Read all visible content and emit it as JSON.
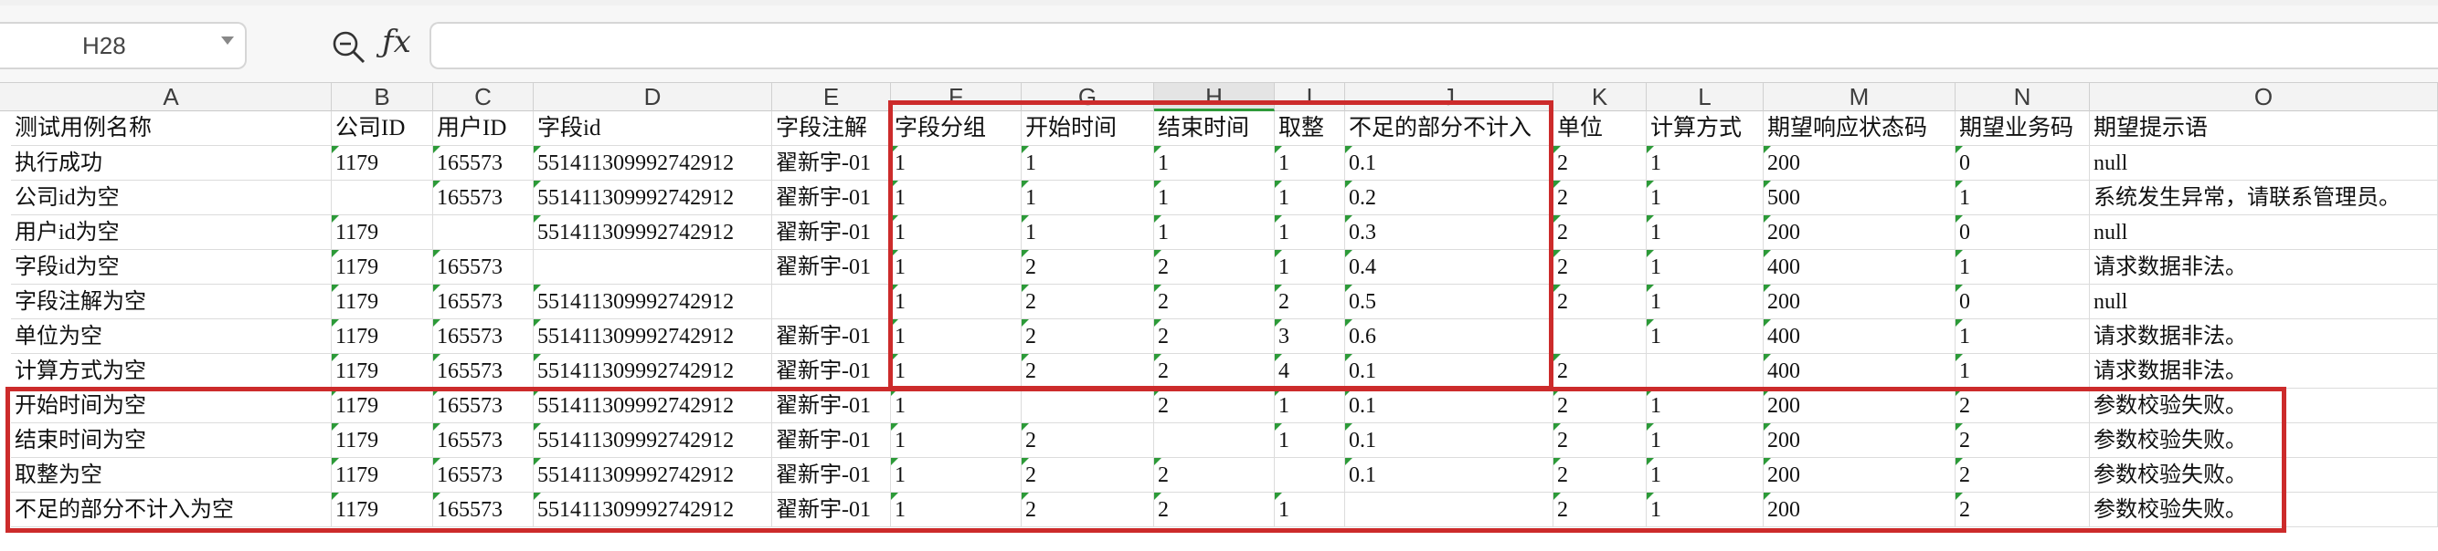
{
  "namebox": {
    "value": "H28"
  },
  "formula": {
    "value": ""
  },
  "columns": [
    "A",
    "B",
    "C",
    "D",
    "E",
    "F",
    "G",
    "H",
    "I",
    "J",
    "K",
    "L",
    "M",
    "N",
    "O"
  ],
  "selected_column": "H",
  "header": [
    "测试用例名称",
    "公司ID",
    "用户ID",
    "字段id",
    "字段注解",
    "字段分组",
    "开始时间",
    "结束时间",
    "取整",
    "不足的部分不计入",
    "单位",
    "计算方式",
    "期望响应状态码",
    "期望业务码",
    "期望提示语"
  ],
  "rows": [
    [
      "执行成功",
      "1179",
      "165573",
      "551411309992742912",
      "翟新宇-01",
      "1",
      "1",
      "1",
      "1",
      "0.1",
      "2",
      "1",
      "200",
      "0",
      "null"
    ],
    [
      "公司id为空",
      "",
      "165573",
      "551411309992742912",
      "翟新宇-01",
      "1",
      "1",
      "1",
      "1",
      "0.2",
      "2",
      "1",
      "500",
      "1",
      "系统发生异常，请联系管理员。"
    ],
    [
      "用户id为空",
      "1179",
      "",
      "551411309992742912",
      "翟新宇-01",
      "1",
      "1",
      "1",
      "1",
      "0.3",
      "2",
      "1",
      "200",
      "0",
      "null"
    ],
    [
      "字段id为空",
      "1179",
      "165573",
      "",
      "翟新宇-01",
      "1",
      "2",
      "2",
      "1",
      "0.4",
      "2",
      "1",
      "400",
      "1",
      "请求数据非法。"
    ],
    [
      "字段注解为空",
      "1179",
      "165573",
      "551411309992742912",
      "",
      "1",
      "2",
      "2",
      "2",
      "0.5",
      "2",
      "1",
      "200",
      "0",
      "null"
    ],
    [
      "单位为空",
      "1179",
      "165573",
      "551411309992742912",
      "翟新宇-01",
      "1",
      "2",
      "2",
      "3",
      "0.6",
      "",
      "1",
      "400",
      "1",
      "请求数据非法。"
    ],
    [
      "计算方式为空",
      "1179",
      "165573",
      "551411309992742912",
      "翟新宇-01",
      "1",
      "2",
      "2",
      "4",
      "0.1",
      "2",
      "",
      "400",
      "1",
      "请求数据非法。"
    ],
    [
      "开始时间为空",
      "1179",
      "165573",
      "551411309992742912",
      "翟新宇-01",
      "1",
      "",
      "2",
      "1",
      "0.1",
      "2",
      "1",
      "200",
      "2",
      "参数校验失败。"
    ],
    [
      "结束时间为空",
      "1179",
      "165573",
      "551411309992742912",
      "翟新宇-01",
      "1",
      "2",
      "",
      "1",
      "0.1",
      "2",
      "1",
      "200",
      "2",
      "参数校验失败。"
    ],
    [
      "取整为空",
      "1179",
      "165573",
      "551411309992742912",
      "翟新宇-01",
      "1",
      "2",
      "2",
      "",
      "0.1",
      "2",
      "1",
      "200",
      "2",
      "参数校验失败。"
    ],
    [
      "不足的部分不计入为空",
      "1179",
      "165573",
      "551411309992742912",
      "翟新宇-01",
      "1",
      "2",
      "2",
      "1",
      "",
      "2",
      "1",
      "200",
      "2",
      "参数校验失败。"
    ]
  ],
  "icons": {
    "zoom": "zoom-formula-icon",
    "fx": "fx-function-icon",
    "dropdown": "chevron-down-icon"
  },
  "colors": {
    "highlight": "#cc2b2b",
    "flag": "#2c9a38",
    "selected_header_underline": "#2e9a3a"
  }
}
